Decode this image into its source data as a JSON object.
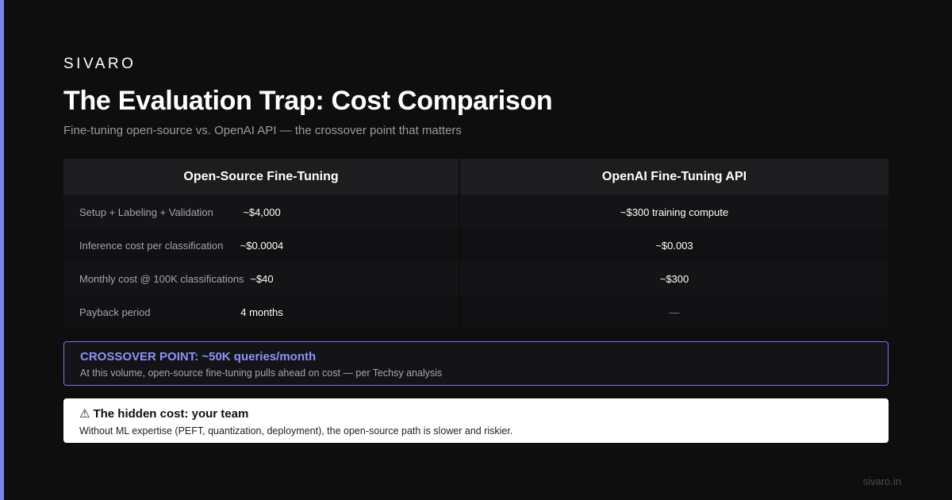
{
  "brand": "SIVARO",
  "title": "The Evaluation Trap: Cost Comparison",
  "subtitle": "Fine-tuning open-source vs. OpenAI API — the crossover point that matters",
  "table": {
    "headers": [
      "Open-Source Fine-Tuning",
      "OpenAI Fine-Tuning API"
    ],
    "rows": [
      {
        "label": "Setup + Labeling + Validation",
        "open_source": "~$4,000",
        "openai": "~$300 training compute"
      },
      {
        "label": "Inference cost per classification",
        "open_source": "~$0.0004",
        "openai": "~$0.003"
      },
      {
        "label": "Monthly cost @ 100K classifications",
        "open_source": "~$40",
        "openai": "~$300"
      },
      {
        "label": "Payback period",
        "open_source": "4 months",
        "openai": "—"
      }
    ]
  },
  "crossover": {
    "headline": "CROSSOVER POINT: ~50K queries/month",
    "detail": "At this volume, open-source fine-tuning pulls ahead on cost — per Techsy analysis"
  },
  "hidden_cost": {
    "icon": "warning-icon",
    "icon_glyph": "⚠",
    "headline": "The hidden cost: your team",
    "detail": "Without ML expertise (PEFT, quantization, deployment), the open-source path is slower and riskier."
  },
  "footer": "sivaro.in",
  "colors": {
    "accent": "#7b83f0",
    "background": "#0e0e0f",
    "crossover_text": "#8c93f5"
  }
}
